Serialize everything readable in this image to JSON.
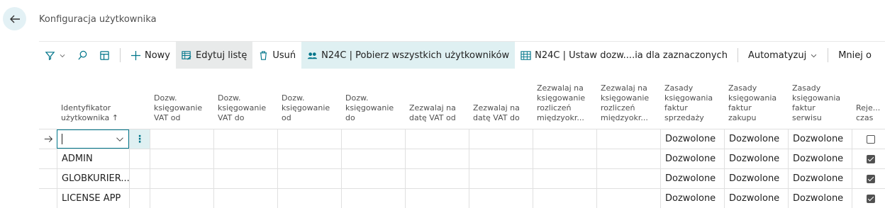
{
  "page": {
    "title": "Konfiguracja użytkownika"
  },
  "actions": {
    "new": "Nowy",
    "edit_list": "Edytuj listę",
    "delete": "Usuń",
    "n24c_fetch": "N24C | Pobierz wszystkich użytkowników",
    "n24c_set": "N24C | Ustaw dozw....ia dla zaznaczonych",
    "automate": "Automatyzuj",
    "less": "Mniej o"
  },
  "columns": {
    "user_id": [
      "Identyfikator",
      "użytkownika ↑"
    ],
    "vat_from": [
      "Dozw.",
      "księgowanie",
      "VAT od"
    ],
    "vat_to": [
      "Dozw.",
      "księgowanie",
      "VAT do"
    ],
    "post_from": [
      "Dozw.",
      "księgowanie",
      "od"
    ],
    "post_to": [
      "Dozw.",
      "księgowanie",
      "do"
    ],
    "allow_vat_from": [
      "Zezwalaj na",
      "datę VAT od"
    ],
    "allow_vat_to": [
      "Zezwalaj na",
      "datę VAT do"
    ],
    "ic_from": [
      "Zezwalaj na",
      "księgowanie",
      "rozliczeń",
      "międzyokr..."
    ],
    "ic_to": [
      "Zezwalaj na",
      "księgowanie",
      "rozliczeń",
      "międzyokr..."
    ],
    "sales_rules": [
      "Zasady",
      "księgowania",
      "faktur",
      "sprzedaży"
    ],
    "purch_rules": [
      "Zasady",
      "księgowania",
      "faktur",
      "zakupu"
    ],
    "service_rules": [
      "Zasady",
      "księgowania",
      "faktur",
      "serwisu"
    ],
    "register": [
      "Reje...",
      "czas"
    ]
  },
  "rows": [
    {
      "user_id": "",
      "sales": "Dozwolone",
      "purch": "Dozwolone",
      "service": "Dozwolone",
      "register": false
    },
    {
      "user_id": "ADMIN",
      "sales": "Dozwolone",
      "purch": "Dozwolone",
      "service": "Dozwolone",
      "register": true
    },
    {
      "user_id": "GLOBKURIER...",
      "sales": "Dozwolone",
      "purch": "Dozwolone",
      "service": "Dozwolone",
      "register": true
    },
    {
      "user_id": "LICENSE APP",
      "sales": "Dozwolone",
      "purch": "Dozwolone",
      "service": "Dozwolone",
      "register": true
    }
  ],
  "colors": {
    "accent": "#00758a",
    "highlight": "#dff0f2"
  }
}
